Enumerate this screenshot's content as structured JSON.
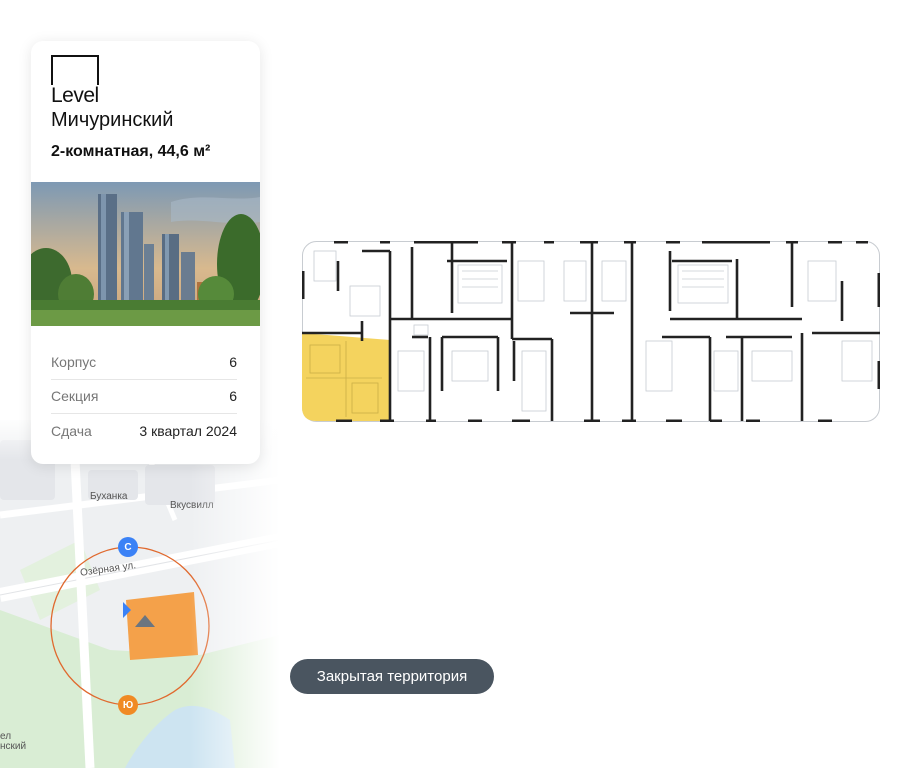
{
  "brand": {
    "word": "Level",
    "project": "Мичуринский"
  },
  "apartment": {
    "title": "2-комнатная, 44,6 м²"
  },
  "info": [
    {
      "label": "Корпус",
      "value": "6"
    },
    {
      "label": "Секция",
      "value": "6"
    },
    {
      "label": "Сдача",
      "value": "3 квартал 2024"
    }
  ],
  "map": {
    "street": "Озёрная ул.",
    "poi": [
      "Буханка",
      "Вкусвилл"
    ],
    "bottom_text": [
      "ел",
      "нский"
    ],
    "compass_north": "С",
    "compass_south": "Ю",
    "building_color": "#f4a14a"
  },
  "plan": {
    "highlight_color": "#f4d35e"
  },
  "badge": {
    "text": "Закрытая территория"
  }
}
